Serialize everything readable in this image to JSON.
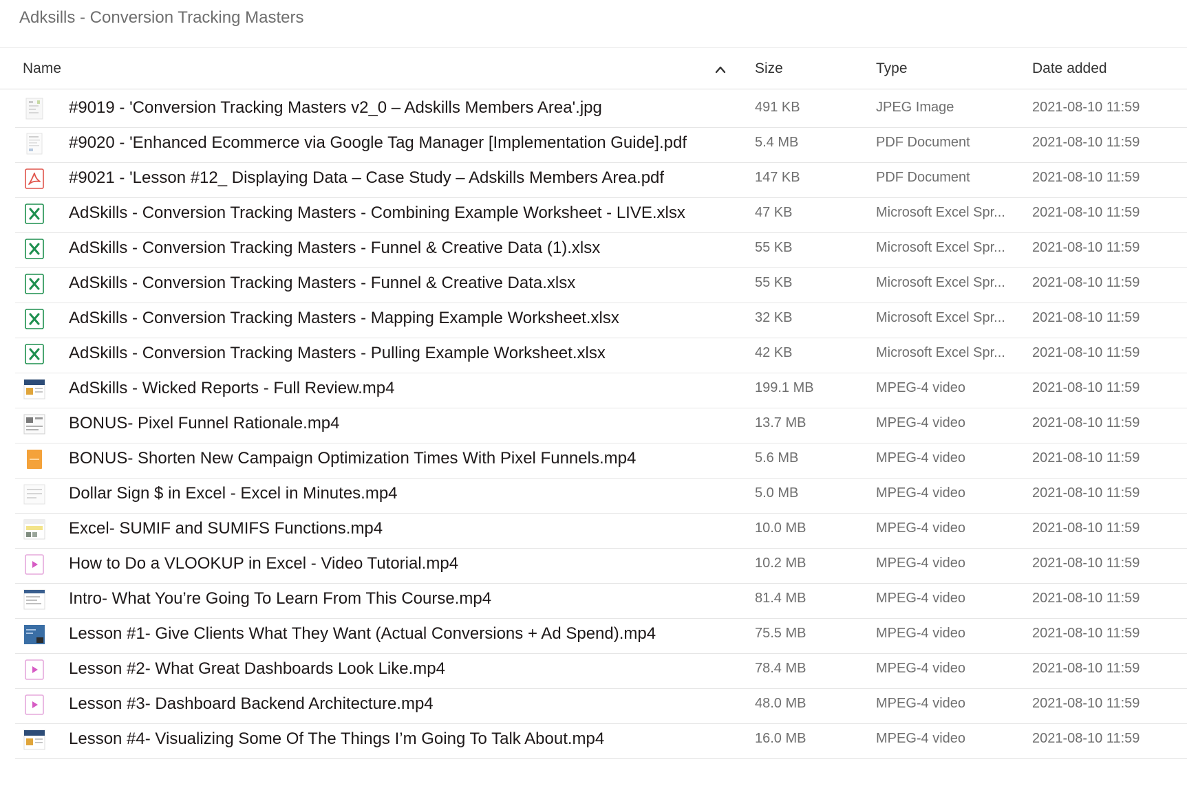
{
  "folder_title": "Adksills - Conversion Tracking Masters",
  "columns": {
    "name": "Name",
    "size": "Size",
    "type": "Type",
    "date": "Date added"
  },
  "files": [
    {
      "name": "#9019 - 'Conversion Tracking Masters v2_0 – Adskills Members Area'.jpg",
      "size": "491 KB",
      "type": "JPEG Image",
      "date": "2021-08-10 11:59",
      "icon": "image-thumbnail-icon"
    },
    {
      "name": "#9020 - 'Enhanced Ecommerce via Google Tag Manager [Implementation Guide].pdf",
      "size": "5.4 MB",
      "type": "PDF Document",
      "date": "2021-08-10 11:59",
      "icon": "document-thumbnail-icon"
    },
    {
      "name": "#9021 - 'Lesson #12_ Displaying Data – Case Study – Adskills Members Area.pdf",
      "size": "147 KB",
      "type": "PDF Document",
      "date": "2021-08-10 11:59",
      "icon": "pdf-icon"
    },
    {
      "name": "AdSkills - Conversion Tracking Masters - Combining Example Worksheet - LIVE.xlsx",
      "size": "47 KB",
      "type": "Microsoft Excel Spr...",
      "date": "2021-08-10 11:59",
      "icon": "excel-icon"
    },
    {
      "name": "AdSkills - Conversion Tracking Masters - Funnel & Creative Data (1).xlsx",
      "size": "55 KB",
      "type": "Microsoft Excel Spr...",
      "date": "2021-08-10 11:59",
      "icon": "excel-icon"
    },
    {
      "name": "AdSkills - Conversion Tracking Masters - Funnel & Creative Data.xlsx",
      "size": "55 KB",
      "type": "Microsoft Excel Spr...",
      "date": "2021-08-10 11:59",
      "icon": "excel-icon"
    },
    {
      "name": "AdSkills - Conversion Tracking Masters - Mapping Example Worksheet.xlsx",
      "size": "32 KB",
      "type": "Microsoft Excel Spr...",
      "date": "2021-08-10 11:59",
      "icon": "excel-icon"
    },
    {
      "name": "AdSkills - Conversion Tracking Masters - Pulling Example Worksheet.xlsx",
      "size": "42 KB",
      "type": "Microsoft Excel Spr...",
      "date": "2021-08-10 11:59",
      "icon": "excel-icon"
    },
    {
      "name": "AdSkills - Wicked Reports - Full Review.mp4",
      "size": "199.1 MB",
      "type": "MPEG-4 video",
      "date": "2021-08-10 11:59",
      "icon": "video-thumbnail-icon"
    },
    {
      "name": "BONUS- Pixel Funnel Rationale.mp4",
      "size": "13.7 MB",
      "type": "MPEG-4 video",
      "date": "2021-08-10 11:59",
      "icon": "video-thumbnail-icon"
    },
    {
      "name": "BONUS- Shorten New Campaign Optimization Times With Pixel Funnels.mp4",
      "size": "5.6 MB",
      "type": "MPEG-4 video",
      "date": "2021-08-10 11:59",
      "icon": "video-thumbnail-icon"
    },
    {
      "name": "Dollar Sign $ in Excel - Excel in Minutes.mp4",
      "size": "5.0 MB",
      "type": "MPEG-4 video",
      "date": "2021-08-10 11:59",
      "icon": "video-thumbnail-icon"
    },
    {
      "name": "Excel- SUMIF and SUMIFS Functions.mp4",
      "size": "10.0 MB",
      "type": "MPEG-4 video",
      "date": "2021-08-10 11:59",
      "icon": "video-thumbnail-icon"
    },
    {
      "name": "How to Do a VLOOKUP in Excel - Video Tutorial.mp4",
      "size": "10.2 MB",
      "type": "MPEG-4 video",
      "date": "2021-08-10 11:59",
      "icon": "video-file-icon"
    },
    {
      "name": "Intro- What You’re Going To Learn From This Course.mp4",
      "size": "81.4 MB",
      "type": "MPEG-4 video",
      "date": "2021-08-10 11:59",
      "icon": "video-thumbnail-icon"
    },
    {
      "name": "Lesson #1- Give Clients What They Want (Actual Conversions + Ad Spend).mp4",
      "size": "75.5 MB",
      "type": "MPEG-4 video",
      "date": "2021-08-10 11:59",
      "icon": "video-thumbnail-icon"
    },
    {
      "name": "Lesson #2- What Great Dashboards Look Like.mp4",
      "size": "78.4 MB",
      "type": "MPEG-4 video",
      "date": "2021-08-10 11:59",
      "icon": "video-file-icon"
    },
    {
      "name": "Lesson #3- Dashboard Backend Architecture.mp4",
      "size": "48.0 MB",
      "type": "MPEG-4 video",
      "date": "2021-08-10 11:59",
      "icon": "video-file-icon"
    },
    {
      "name": "Lesson #4- Visualizing Some Of The Things I’m Going To Talk About.mp4",
      "size": "16.0 MB",
      "type": "MPEG-4 video",
      "date": "2021-08-10 11:59",
      "icon": "video-thumbnail-icon"
    }
  ]
}
